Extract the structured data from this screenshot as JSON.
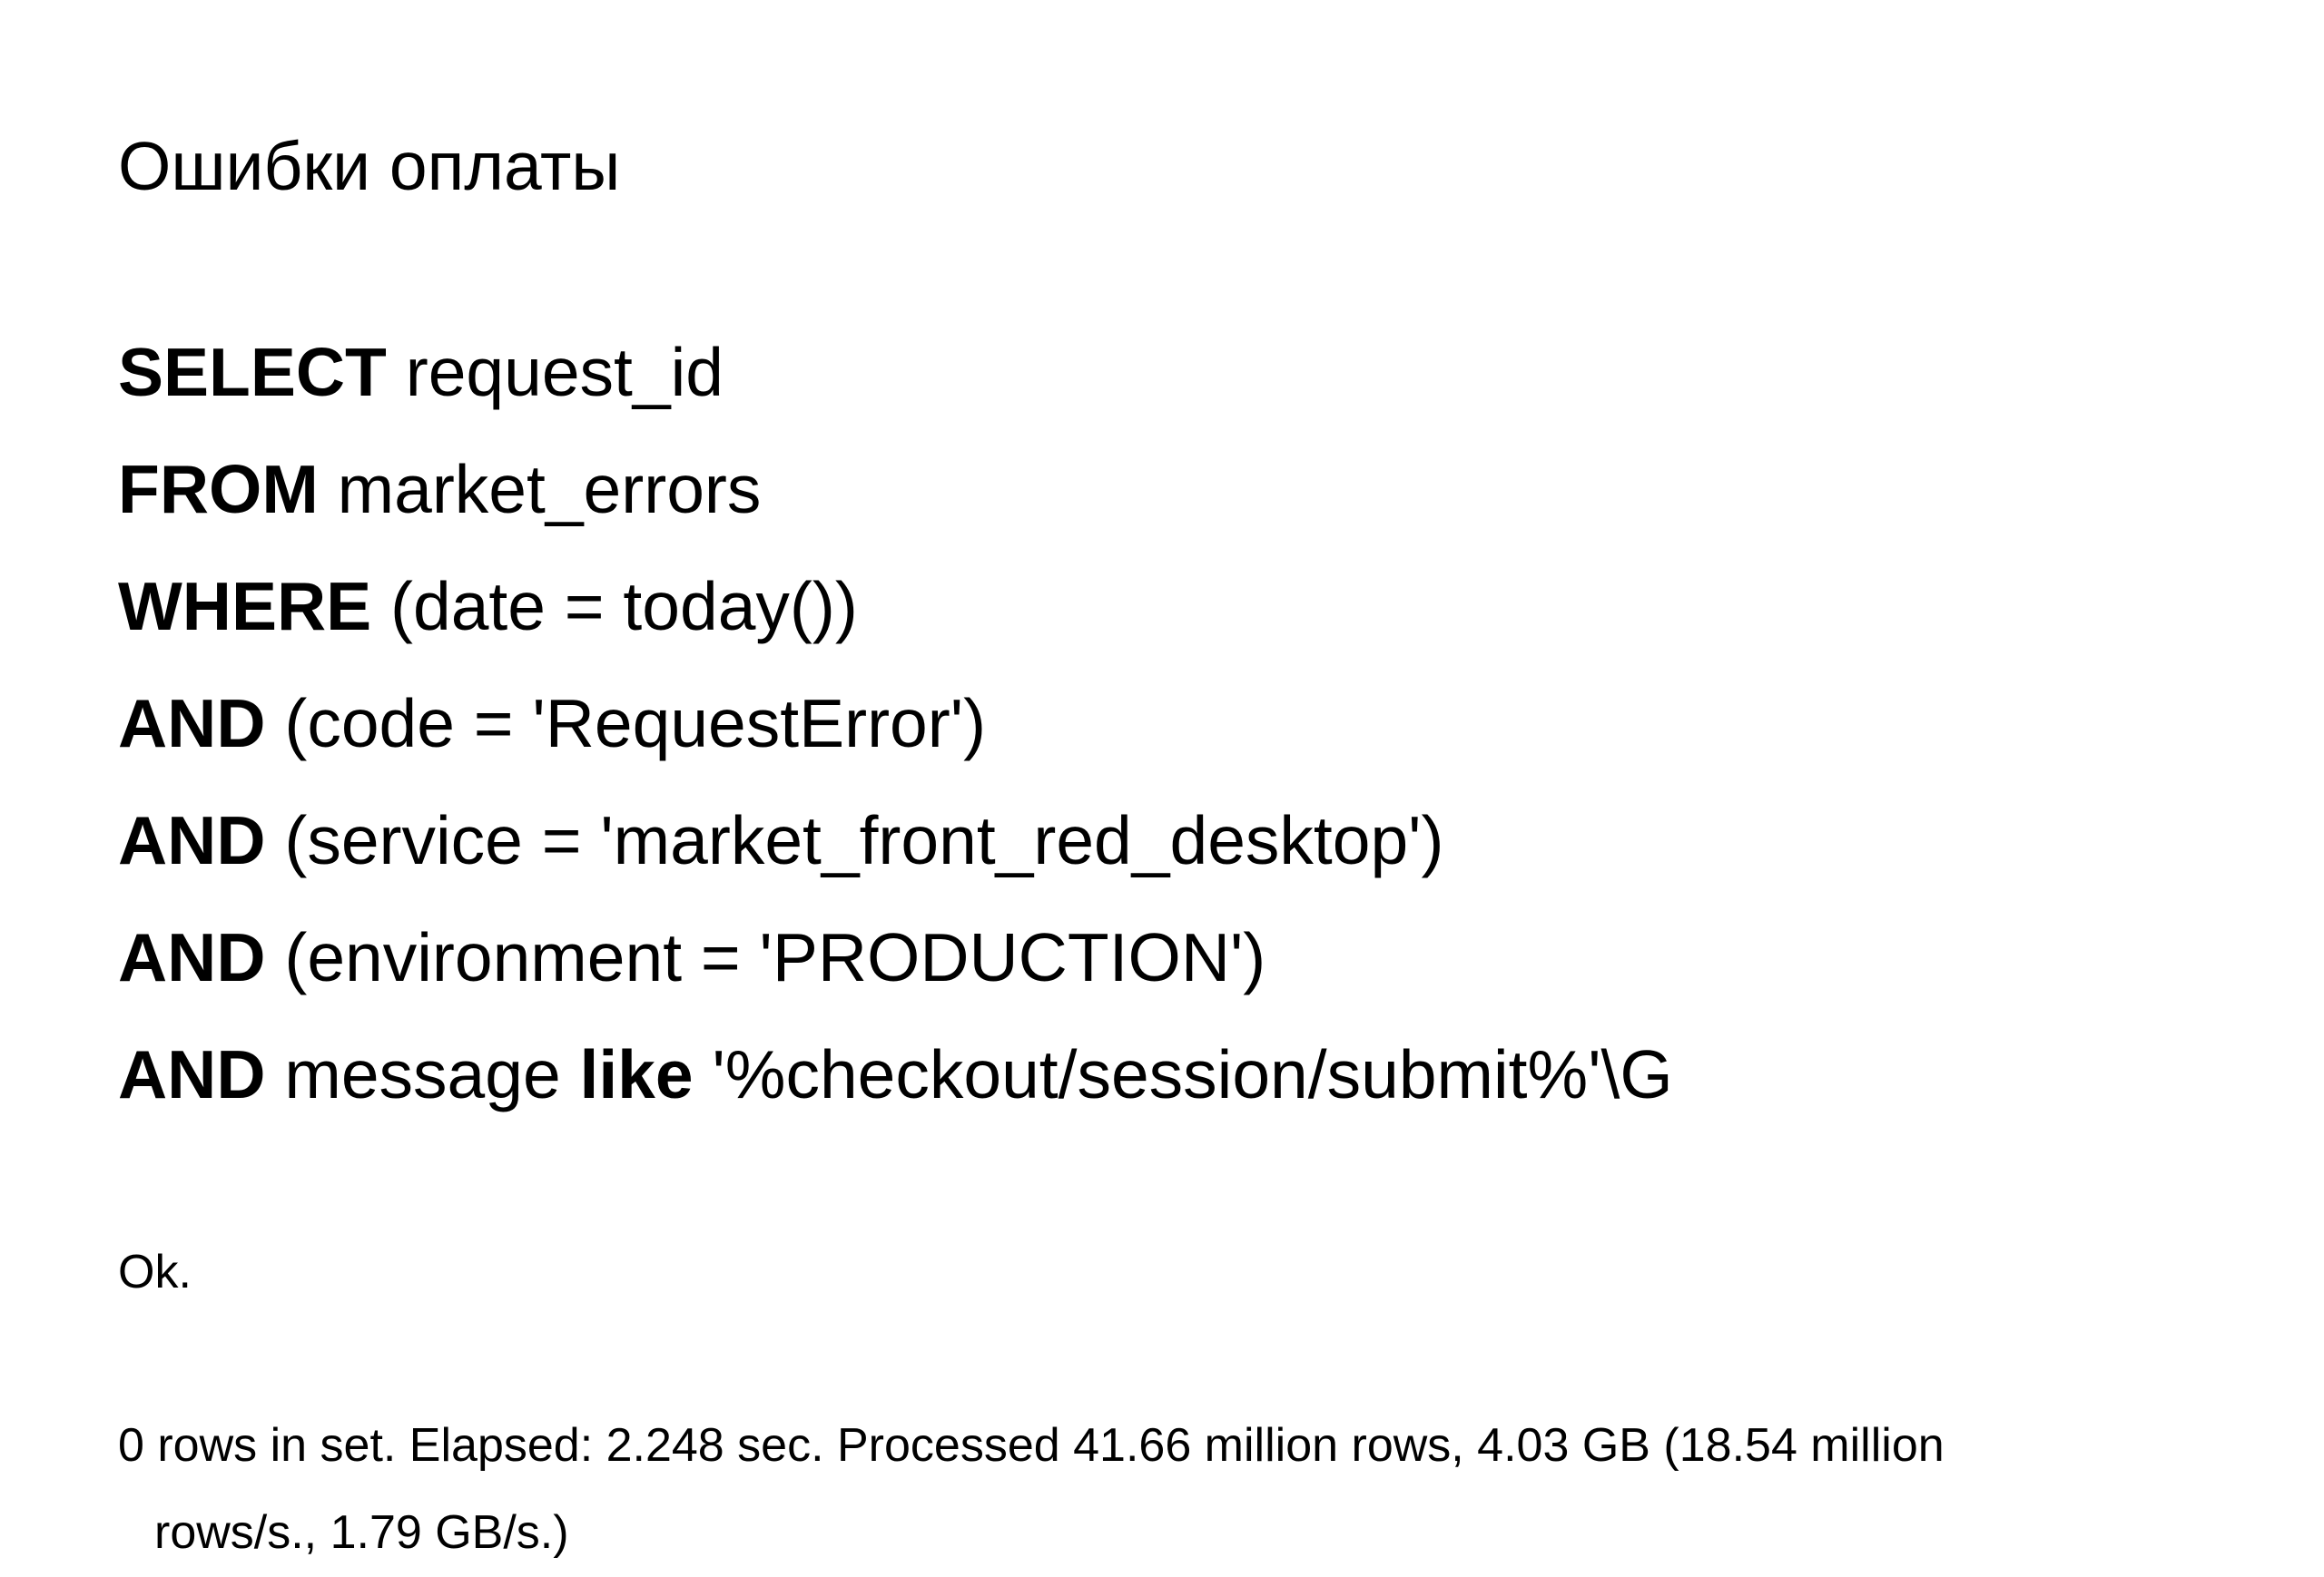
{
  "title": "Ошибки оплаты",
  "sql": {
    "line1": {
      "kw": "SELECT",
      "rest": " request_id"
    },
    "line2": {
      "kw": "FROM",
      "rest": " market_errors"
    },
    "line3": {
      "kw": "WHERE",
      "rest": " (date = today())"
    },
    "line4": {
      "kw": "AND",
      "rest": " (code = 'RequestError')"
    },
    "line5": {
      "kw": "AND",
      "rest": " (service = 'market_front_red_desktop')"
    },
    "line6": {
      "kw": "AND",
      "rest": " (environment = 'PRODUCTION')"
    },
    "line7": {
      "kw_and": "AND",
      "mid": " message ",
      "kw_like": "like",
      "rest": " '%checkout/session/submit%'\\G"
    }
  },
  "result": {
    "ok": "Ok.",
    "stats_line1": "0 rows in set. Elapsed: 2.248 sec. Processed 41.66 million rows, 4.03 GB (18.54 million",
    "stats_line2": "rows/s., 1.79 GB/s.)"
  }
}
